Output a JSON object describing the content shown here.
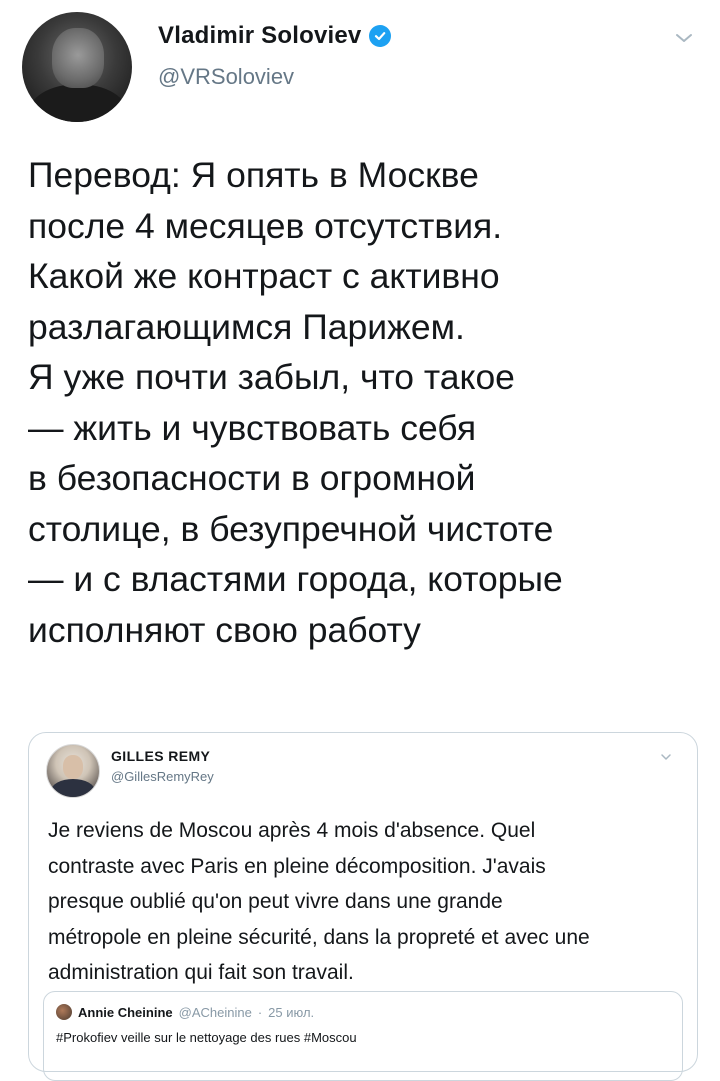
{
  "author": {
    "display_name": "Vladimir Soloviev",
    "handle": "@VRSoloviev",
    "verified": true
  },
  "tweet": {
    "lines": [
      "Перевод: Я опять в Москве",
      "после 4 месяцев отсутствия.",
      "Какой же контраст с активно",
      "разлагающимся Парижем.",
      "Я уже почти забыл, что такое",
      "— жить и чувствовать себя",
      "в безопасности в огромной",
      "столице, в безупречной чистоте",
      "— и с властями города, которые",
      "исполняют свою работу"
    ]
  },
  "quoted": {
    "display_name": "GILLES REMY",
    "handle": "@GillesRemyRey",
    "lines": [
      "Je reviens de Moscou après 4 mois d'absence. Quel",
      "contraste avec Paris en pleine décomposition. J'avais",
      "presque oublié qu'on peut vivre dans une grande",
      "métropole en pleine sécurité, dans la propreté et avec une",
      "administration qui fait son travail."
    ],
    "inner": {
      "display_name": "Annie Cheinine",
      "handle": "@ACheinine",
      "separator": "·",
      "date": "25 июл.",
      "text": "#Prokofiev veille sur le nettoyage des rues #Moscou"
    }
  },
  "icons": {
    "verified": "verified-check-icon",
    "menu": "chevron-down-icon"
  },
  "colors": {
    "verified_blue": "#1da1f2",
    "secondary_text": "#657786",
    "border": "#ccd6dd"
  }
}
